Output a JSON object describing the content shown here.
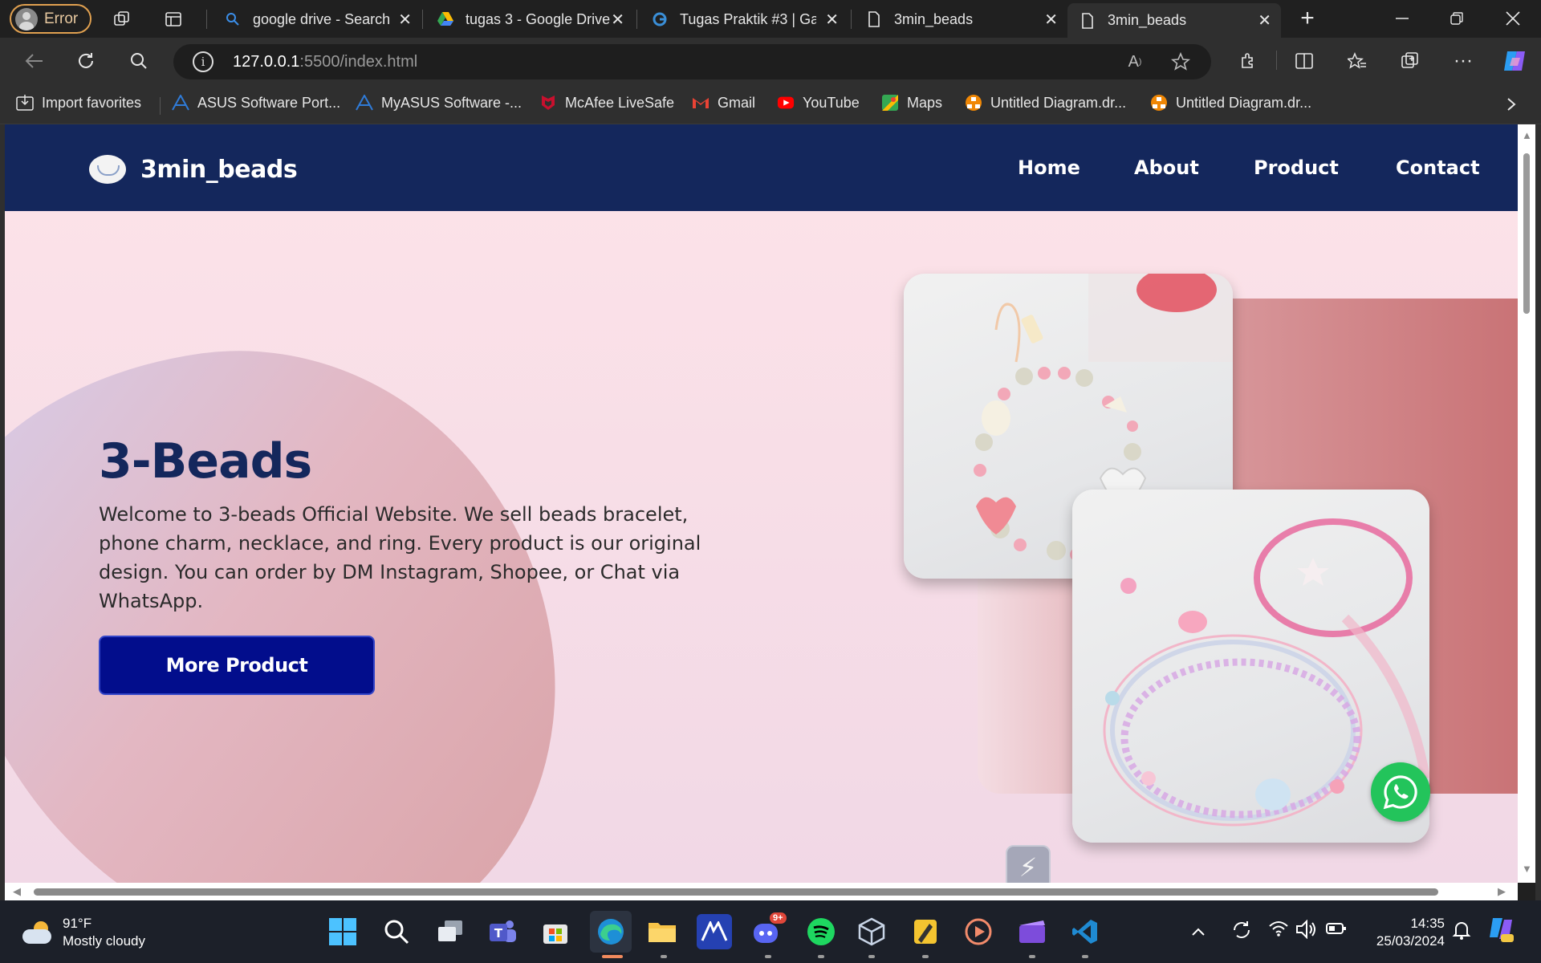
{
  "browser": {
    "profile_label": "Error",
    "tabs": [
      {
        "title": "google drive - Search",
        "icon": "search-icon"
      },
      {
        "title": "tugas 3 - Google Drive",
        "icon": "google-drive-icon"
      },
      {
        "title": "Tugas Praktik #3 | Ga",
        "icon": "gamma-icon"
      },
      {
        "title": "3min_beads",
        "icon": "document-icon"
      },
      {
        "title": "3min_beads",
        "icon": "document-icon"
      }
    ],
    "active_tab_index": 4,
    "address": {
      "host": "127.0.0.1",
      "rest": ":5500/index.html"
    },
    "favorites": [
      {
        "label": "Import favorites",
        "icon": "import-icon",
        "color": "#e6e6e6"
      },
      {
        "label": "ASUS Software Port...",
        "icon": "asus-icon",
        "color": "#2f7bd8"
      },
      {
        "label": "MyASUS Software -...",
        "icon": "asus-icon",
        "color": "#2f7bd8"
      },
      {
        "label": "McAfee LiveSafe",
        "icon": "mcafee-icon",
        "color": "#c8102e"
      },
      {
        "label": "Gmail",
        "icon": "gmail-icon",
        "color": "#ea4335"
      },
      {
        "label": "YouTube",
        "icon": "youtube-icon",
        "color": "#ff0000"
      },
      {
        "label": "Maps",
        "icon": "maps-icon",
        "color": "#34a853"
      },
      {
        "label": "Untitled Diagram.dr...",
        "icon": "drawio-icon",
        "color": "#f08705"
      },
      {
        "label": "Untitled Diagram.dr...",
        "icon": "drawio-icon",
        "color": "#f08705"
      }
    ]
  },
  "site": {
    "brand": "3min_beads",
    "nav": [
      "Home",
      "About",
      "Product",
      "Contact"
    ],
    "hero": {
      "title": "3-Beads",
      "text": "Welcome to 3-beads Official Website. We sell beads bracelet, phone charm, necklace, and ring. Every product is our original design. You can order by DM Instagram, Shopee, or Chat via WhatsApp.",
      "button": "More Product"
    },
    "colors": {
      "header": "#14275c",
      "button": "#020d8c",
      "whatsapp": "#23c45b",
      "accent_panel": "#c97376"
    }
  },
  "taskbar": {
    "weather": {
      "temp": "91°F",
      "condition": "Mostly cloudy"
    },
    "clock": {
      "time": "14:35",
      "date": "25/03/2024"
    },
    "discord_badge": "9+",
    "apps": [
      "start-icon",
      "search-icon",
      "task-view-icon",
      "teams-icon",
      "store-icon",
      "edge-icon",
      "file-explorer-icon",
      "app-icon",
      "discord-icon",
      "spotify-icon",
      "virtualbox-icon",
      "app-icon",
      "media-player-icon",
      "clipchamp-icon",
      "vscode-icon"
    ]
  }
}
